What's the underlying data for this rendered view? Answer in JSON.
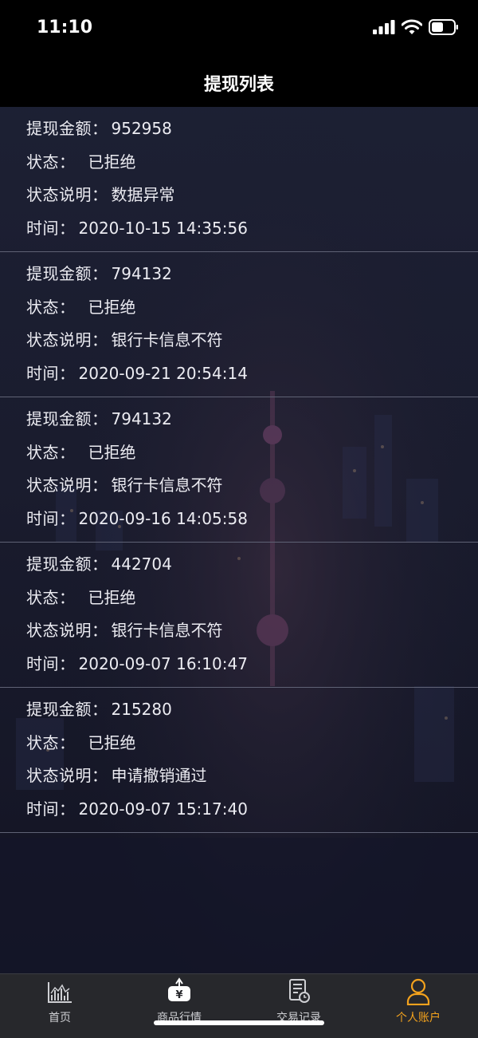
{
  "status_bar": {
    "time": "11:10"
  },
  "nav": {
    "title": "提现列表"
  },
  "labels": {
    "amount": "提现金额：",
    "status": "状态：",
    "note": "状态说明：",
    "time": "时间："
  },
  "records": [
    {
      "amount": "952958",
      "status": "已拒绝",
      "note": "数据异常",
      "time": "2020-10-15 14:35:56"
    },
    {
      "amount": "794132",
      "status": "已拒绝",
      "note": "银行卡信息不符",
      "time": "2020-09-21 20:54:14"
    },
    {
      "amount": "794132",
      "status": "已拒绝",
      "note": "银行卡信息不符",
      "time": "2020-09-16 14:05:58"
    },
    {
      "amount": "442704",
      "status": "已拒绝",
      "note": "银行卡信息不符",
      "time": "2020-09-07 16:10:47"
    },
    {
      "amount": "215280",
      "status": "已拒绝",
      "note": "申请撤销通过",
      "time": "2020-09-07 15:17:40"
    }
  ],
  "tabbar": {
    "items": [
      {
        "label": "首页",
        "icon": "chart-icon"
      },
      {
        "label": "商品行情",
        "icon": "yen-box-icon"
      },
      {
        "label": "交易记录",
        "icon": "document-clock-icon"
      },
      {
        "label": "个人账户",
        "icon": "person-icon"
      }
    ],
    "active_index": 3,
    "active_color": "#f3a21d",
    "inactive_color": "#cfd0d4"
  }
}
